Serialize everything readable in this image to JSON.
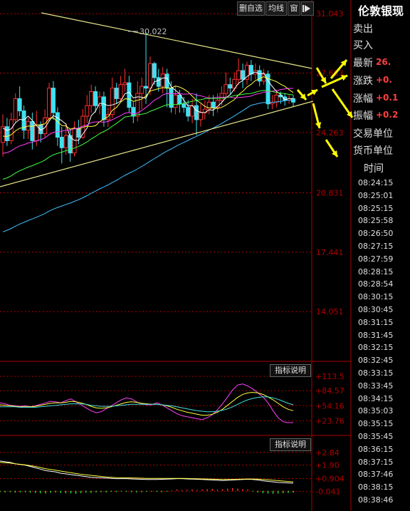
{
  "toolbar": {
    "add_favorite": "删自选",
    "ma": "均线",
    "window": "窗",
    "panel_toggle": "arrow-right-icon"
  },
  "quote_panel": {
    "title": "伦敦银现",
    "ask_label": "卖出",
    "bid_label": "买入",
    "last_label": "最新",
    "last_value": "26.",
    "change_label": "涨跌",
    "change_value": "+0.",
    "change_pct_label": "涨幅",
    "change_pct_value": "+0.1",
    "amplitude_label": "振幅",
    "amplitude_value": "+0.2",
    "trade_unit_label": "交易单位",
    "currency_label": "货币单位",
    "time_header": "时间",
    "times": [
      "08:24:15",
      "08:25:01",
      "08:25:15",
      "08:25:58",
      "08:26:50",
      "08:27:15",
      "08:27:59",
      "08:28:15",
      "08:28:54",
      "08:30:15",
      "08:30:45",
      "08:31:15",
      "08:31:45",
      "08:32:15",
      "08:32:45",
      "08:33:15",
      "08:33:45",
      "08:34:15",
      "08:35:03",
      "08:35:15",
      "08:35:45",
      "08:36:15",
      "08:37:15",
      "08:37:46",
      "08:38:15",
      "08:38:46"
    ]
  },
  "colors": {
    "up": "#ff3030",
    "down": "#40e0f0",
    "ma5": "#ffffff",
    "ma10": "#ffff40",
    "ma20": "#ff40ff",
    "ma30": "#40ff40",
    "ma60": "#40c0ff",
    "trend": "#e6e68a",
    "arrow": "#ffff00",
    "axis": "#b00000"
  },
  "chart_data": [
    {
      "type": "candlestick",
      "ylim": [
        11.5,
        31.5
      ],
      "y_tick_labels": [
        "31.043",
        "27.653",
        "24.263",
        "20.831",
        "17.441",
        "14.051"
      ],
      "annotation": "30.022",
      "candles": [
        [
          23.7,
          24.6,
          25.3,
          22.9
        ],
        [
          24.6,
          23.8,
          25.1,
          23.5
        ],
        [
          23.8,
          25.0,
          25.4,
          23.6
        ],
        [
          25.0,
          26.2,
          26.5,
          24.8
        ],
        [
          26.2,
          25.5,
          26.9,
          25.2
        ],
        [
          25.5,
          24.4,
          25.8,
          23.9
        ],
        [
          24.4,
          24.9,
          25.1,
          23.9
        ],
        [
          24.9,
          23.8,
          25.4,
          23.3
        ],
        [
          23.8,
          24.7,
          25.5,
          23.5
        ],
        [
          24.7,
          24.2,
          24.9,
          23.7
        ],
        [
          24.2,
          25.1,
          25.6,
          24.0
        ],
        [
          25.1,
          26.8,
          27.1,
          24.9
        ],
        [
          26.8,
          25.4,
          27.2,
          25.0
        ],
        [
          25.4,
          24.0,
          25.7,
          23.5
        ],
        [
          24.0,
          23.4,
          24.6,
          22.5
        ],
        [
          23.4,
          24.1,
          24.8,
          23.0
        ],
        [
          24.1,
          23.1,
          24.5,
          22.6
        ],
        [
          23.1,
          24.5,
          24.9,
          22.9
        ],
        [
          24.5,
          24.0,
          25.0,
          23.6
        ],
        [
          24.0,
          25.2,
          25.6,
          23.9
        ],
        [
          25.2,
          25.8,
          26.4,
          24.8
        ],
        [
          25.8,
          26.6,
          27.0,
          25.4
        ],
        [
          26.6,
          25.8,
          26.9,
          25.4
        ],
        [
          25.8,
          26.3,
          26.6,
          25.3
        ],
        [
          26.3,
          25.0,
          26.6,
          24.6
        ],
        [
          25.0,
          25.3,
          25.7,
          24.6
        ],
        [
          25.3,
          26.8,
          27.4,
          25.1
        ],
        [
          26.8,
          26.2,
          27.1,
          25.9
        ],
        [
          26.2,
          27.0,
          27.5,
          26.0
        ],
        [
          27.0,
          27.1,
          27.9,
          26.6
        ],
        [
          27.1,
          25.7,
          27.5,
          25.4
        ],
        [
          25.7,
          25.2,
          26.0,
          24.8
        ],
        [
          25.2,
          26.5,
          27.2,
          24.9
        ],
        [
          26.5,
          26.9,
          27.4,
          25.6
        ],
        [
          26.9,
          26.8,
          30.0,
          25.9
        ],
        [
          26.8,
          28.2,
          28.6,
          26.4
        ],
        [
          28.2,
          27.4,
          28.3,
          27.0
        ],
        [
          27.4,
          26.9,
          27.9,
          26.6
        ],
        [
          26.9,
          27.6,
          28.0,
          26.5
        ],
        [
          27.6,
          26.8,
          27.9,
          25.7
        ],
        [
          26.8,
          25.7,
          27.2,
          25.4
        ],
        [
          25.7,
          26.4,
          26.9,
          25.3
        ],
        [
          26.4,
          25.9,
          26.7,
          25.4
        ],
        [
          25.9,
          25.7,
          26.3,
          25.4
        ],
        [
          25.7,
          25.2,
          26.1,
          24.9
        ],
        [
          25.2,
          25.8,
          26.2,
          24.8
        ],
        [
          25.8,
          25.0,
          26.5,
          24.1
        ],
        [
          25.0,
          25.4,
          25.9,
          24.6
        ],
        [
          25.4,
          25.6,
          26.1,
          25.0
        ],
        [
          25.6,
          26.0,
          26.4,
          25.3
        ],
        [
          26.0,
          25.7,
          26.4,
          25.2
        ],
        [
          25.7,
          26.1,
          26.5,
          25.4
        ],
        [
          26.1,
          26.5,
          26.9,
          25.8
        ],
        [
          26.5,
          27.0,
          27.7,
          26.2
        ],
        [
          27.0,
          26.8,
          27.4,
          26.4
        ],
        [
          26.8,
          27.3,
          27.7,
          26.6
        ],
        [
          27.3,
          27.8,
          28.5,
          27.0
        ],
        [
          27.8,
          27.3,
          28.2,
          26.8
        ],
        [
          27.3,
          28.1,
          28.3,
          27.0
        ],
        [
          28.1,
          27.6,
          28.4,
          27.2
        ],
        [
          27.6,
          27.8,
          28.2,
          27.3
        ],
        [
          27.8,
          27.2,
          28.1,
          26.9
        ],
        [
          27.2,
          27.6,
          27.9,
          27.0
        ],
        [
          27.6,
          25.9,
          27.8,
          25.6
        ],
        [
          25.9,
          26.0,
          26.4,
          25.6
        ],
        [
          26.0,
          26.4,
          26.7,
          25.7
        ],
        [
          26.4,
          26.3,
          26.6,
          25.9
        ],
        [
          26.3,
          26.1,
          26.5,
          25.8
        ],
        [
          26.1,
          26.2,
          26.4,
          25.9
        ],
        [
          26.2,
          26.0,
          26.4,
          25.7
        ]
      ]
    },
    {
      "type": "line",
      "title": "指标说明",
      "ylim": [
        10,
        125
      ],
      "y_tick_labels": [
        "+113.5",
        "+84.57",
        "+54.16",
        "+23.76"
      ],
      "series": [
        {
          "values": [
            60,
            58,
            55,
            54,
            53,
            54,
            52,
            54,
            57,
            60,
            63,
            62,
            60,
            64,
            68,
            62,
            56,
            50,
            44,
            40,
            42,
            48,
            54,
            60,
            66,
            70,
            68,
            62,
            58,
            56,
            56,
            60,
            56,
            50,
            44,
            38,
            34,
            32,
            30,
            28,
            26,
            30,
            36,
            46,
            58,
            72,
            86,
            96,
            98,
            94,
            88,
            80,
            72,
            60,
            44,
            30,
            22,
            20,
            20
          ]
        },
        {
          "values": [
            56,
            55,
            54,
            53,
            52,
            52,
            52,
            53,
            55,
            57,
            59,
            60,
            60,
            61,
            63,
            62,
            60,
            57,
            53,
            50,
            49,
            50,
            52,
            55,
            58,
            61,
            62,
            61,
            59,
            58,
            57,
            57,
            56,
            54,
            51,
            47,
            44,
            41,
            39,
            37,
            35,
            35,
            37,
            41,
            47,
            55,
            63,
            71,
            77,
            80,
            81,
            80,
            77,
            72,
            66,
            59,
            52,
            47,
            44
          ]
        },
        {
          "values": [
            52,
            52,
            52,
            52,
            51,
            51,
            51,
            51,
            52,
            53,
            54,
            55,
            56,
            57,
            58,
            58,
            58,
            57,
            55,
            54,
            53,
            53,
            53,
            54,
            55,
            56,
            57,
            57,
            57,
            57,
            57,
            57,
            56,
            55,
            54,
            52,
            50,
            48,
            46,
            44,
            43,
            42,
            42,
            43,
            45,
            48,
            52,
            57,
            62,
            66,
            69,
            71,
            72,
            72,
            70,
            67,
            63,
            59,
            56
          ]
        }
      ]
    },
    {
      "type": "line",
      "title": "指标说明",
      "ylim": [
        -0.6,
        3.2
      ],
      "y_tick_labels": [
        "+2.84",
        "+1.90",
        "+0.904",
        "-0.041"
      ],
      "series": [
        {
          "values": [
            2.2,
            2.15,
            2.1,
            2.0,
            1.95,
            1.9,
            1.8,
            1.7,
            1.6,
            1.5,
            1.45,
            1.4,
            1.3,
            1.25,
            1.2,
            1.15,
            1.1,
            1.05,
            1.0,
            0.98,
            0.96,
            0.94,
            0.92,
            0.9,
            0.9,
            0.9,
            0.88,
            0.86,
            0.85,
            0.84,
            0.84,
            0.84,
            0.85,
            0.86,
            0.88,
            0.9,
            0.9,
            0.88,
            0.86,
            0.85,
            0.84,
            0.82,
            0.8,
            0.78,
            0.76,
            0.78,
            0.8,
            0.82,
            0.84,
            0.85,
            0.84,
            0.8,
            0.74,
            0.7,
            0.66,
            0.62,
            0.6,
            0.58,
            0.56
          ]
        },
        {
          "values": [
            2.1,
            2.08,
            2.05,
            2.0,
            1.96,
            1.92,
            1.86,
            1.8,
            1.72,
            1.64,
            1.58,
            1.52,
            1.46,
            1.4,
            1.34,
            1.28,
            1.22,
            1.18,
            1.14,
            1.1,
            1.06,
            1.02,
            1.0,
            0.98,
            0.97,
            0.96,
            0.95,
            0.94,
            0.93,
            0.92,
            0.92,
            0.92,
            0.92,
            0.92,
            0.92,
            0.92,
            0.92,
            0.91,
            0.9,
            0.89,
            0.88,
            0.87,
            0.86,
            0.85,
            0.84,
            0.84,
            0.84,
            0.85,
            0.86,
            0.87,
            0.87,
            0.86,
            0.84,
            0.81,
            0.78,
            0.75,
            0.72,
            0.69,
            0.66
          ]
        },
        {
          "values": [
            -0.1,
            -0.12,
            -0.1,
            -0.14,
            -0.12,
            -0.1,
            -0.14,
            -0.16,
            -0.18,
            -0.2,
            -0.15,
            -0.12,
            -0.16,
            -0.18,
            -0.2,
            -0.22,
            -0.18,
            -0.14,
            -0.16,
            -0.12,
            -0.1,
            -0.12,
            -0.08,
            -0.1,
            -0.06,
            -0.08,
            -0.1,
            -0.12,
            -0.1,
            -0.08,
            -0.06,
            -0.08,
            -0.1,
            -0.06,
            0.04,
            0.1,
            0.06,
            0.08,
            0.1,
            0.06,
            0.1,
            0.12,
            0.14,
            0.08,
            0.12,
            0.16,
            0.2,
            0.16,
            0.12,
            0.1,
            -0.06,
            -0.12,
            -0.18,
            -0.2,
            -0.22,
            -0.2,
            -0.18,
            -0.16,
            -0.14
          ]
        }
      ]
    }
  ]
}
